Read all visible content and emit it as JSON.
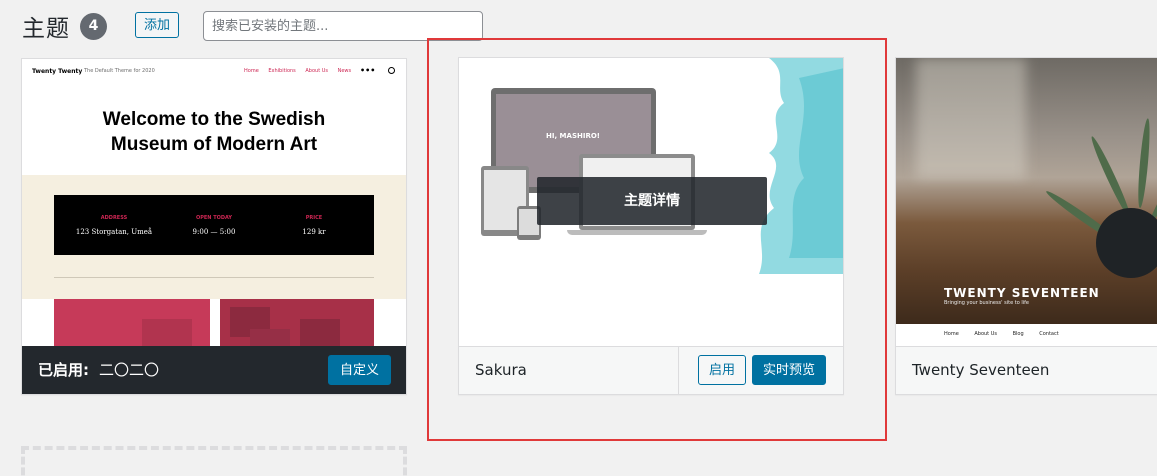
{
  "header": {
    "title": "主题",
    "count": "4",
    "add_label": "添加",
    "search_placeholder": "搜索已安装的主题..."
  },
  "themes": {
    "twenty_twenty": {
      "brand": "Twenty Twenty",
      "tagline": "The Default Theme for 2020",
      "nav": [
        "Home",
        "Exhibitions",
        "About Us",
        "News"
      ],
      "headline_line1": "Welcome to the Swedish",
      "headline_line2": "Museum of Modern Art",
      "info": [
        {
          "label": "ADDRESS",
          "value": "123 Storgatan, Umeå"
        },
        {
          "label": "OPEN TODAY",
          "value": "9:00 — 5:00"
        },
        {
          "label": "PRICE",
          "value": "129 kr"
        }
      ],
      "active_prefix": "已启用:",
      "active_name": "二〇二〇",
      "customize_label": "自定义"
    },
    "sakura": {
      "screen_title": "HI, MASHIRO!",
      "details_label": "主题详情",
      "name": "Sakura",
      "activate_label": "启用",
      "preview_label": "实时预览"
    },
    "twenty_seventeen": {
      "screenshot_title": "TWENTY SEVENTEEN",
      "screenshot_tagline": "Bringing your business' site to life",
      "nav": [
        "Home",
        "About Us",
        "Blog",
        "Contact"
      ],
      "name": "Twenty Seventeen"
    }
  },
  "colors": {
    "accent": "#0071a1",
    "highlight": "#e0393a",
    "active_footer": "#23282d"
  }
}
